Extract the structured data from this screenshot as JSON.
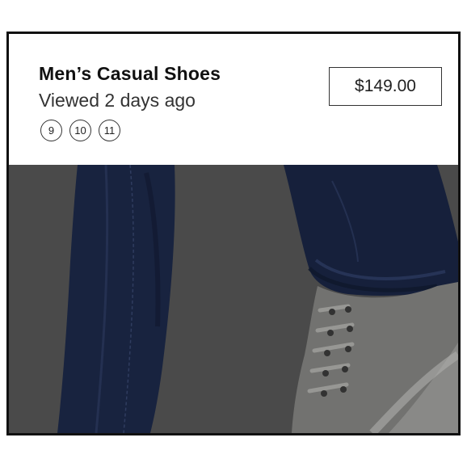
{
  "product": {
    "title": "Men’s Casual Shoes",
    "viewed_text": "Viewed 2 days ago",
    "sizes": [
      "9",
      "10",
      "11"
    ],
    "price": "$149.00",
    "image_description_icon": "jeans-and-sneaker-photo"
  },
  "colors": {
    "border": "#111111",
    "overlay": "#5a5a5a",
    "denim": "#1d2a4a",
    "shoe": "#8a8a88"
  }
}
